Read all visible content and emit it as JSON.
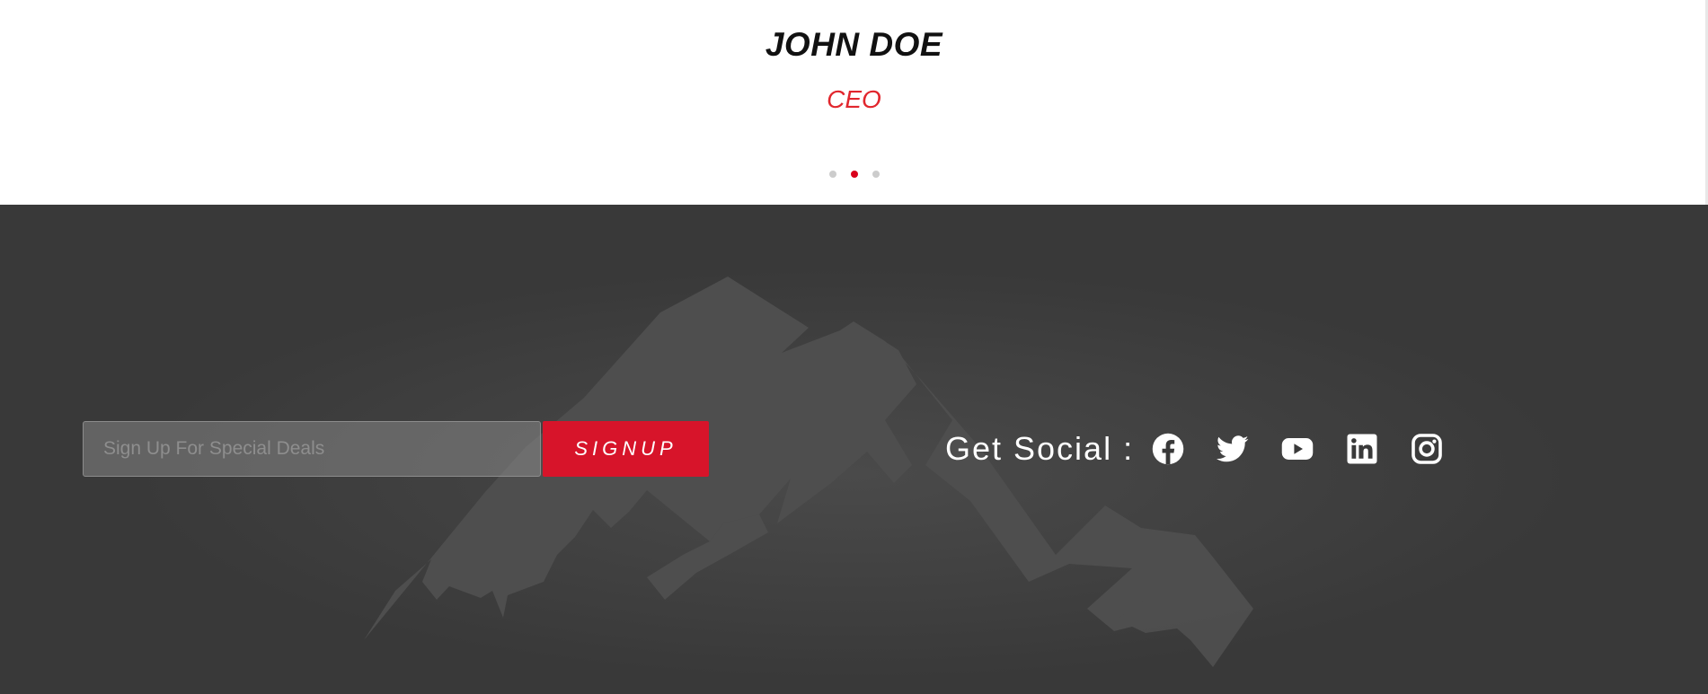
{
  "testimonial": {
    "name": "JOHN DOE",
    "role": "CEO",
    "carousel": {
      "slide_count": 3,
      "active_index": 1
    }
  },
  "signup": {
    "placeholder": "Sign Up For Special Deals",
    "button_label": "SIGNUP"
  },
  "social": {
    "label": "Get Social :",
    "icons": [
      "facebook-icon",
      "twitter-icon",
      "youtube-icon",
      "linkedin-icon",
      "instagram-icon"
    ]
  },
  "colors": {
    "accent": "#d7142a",
    "role_text": "#e1262d",
    "footer_bg": "#393939",
    "active_dot": "#d9001b",
    "inactive_dot": "#cccccc"
  }
}
